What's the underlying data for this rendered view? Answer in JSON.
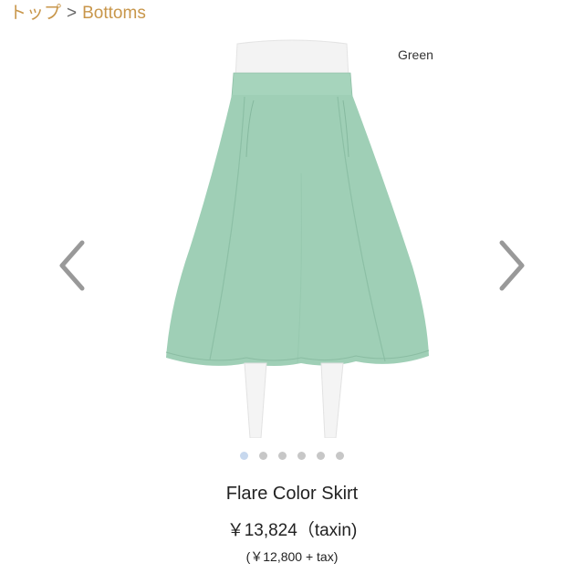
{
  "breadcrumb": {
    "home": "トップ",
    "separator": ">",
    "current": "Bottoms"
  },
  "product": {
    "color_label": "Green",
    "name": "Flare Color Skirt",
    "price": "￥13,824（taxin)",
    "price_before_tax": "(￥12,800 + tax)"
  },
  "carousel": {
    "slide_count": 6,
    "active_index": 0,
    "prev_icon": "chevron-left-icon",
    "next_icon": "chevron-right-icon"
  },
  "colors": {
    "link": "#c8964a",
    "skirt": "#9fcfb6",
    "dot": "#c7c7c7",
    "dot_active": "#c7d8ee"
  }
}
